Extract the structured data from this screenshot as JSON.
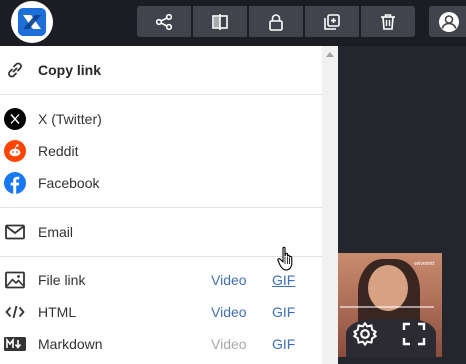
{
  "toolbar": {
    "logo": "app-logo",
    "buttons": [
      "share-icon",
      "compare-icon",
      "lock-icon",
      "add-to-collection-icon",
      "trash-icon"
    ],
    "account": "user-icon"
  },
  "share_menu": {
    "copy_link": "Copy link",
    "social": [
      {
        "label": "X (Twitter)",
        "icon": "x-twitter-icon",
        "color": "#000000"
      },
      {
        "label": "Reddit",
        "icon": "reddit-icon",
        "color": "#ff4500"
      },
      {
        "label": "Facebook",
        "icon": "facebook-icon",
        "color": "#1877f2"
      }
    ],
    "email": "Email",
    "embeds": [
      {
        "label": "File link",
        "video": "Video",
        "gif": "GIF"
      },
      {
        "label": "HTML",
        "video": "Video",
        "gif": "GIF"
      },
      {
        "label": "Markdown",
        "video": "Video",
        "gif": "GIF"
      }
    ]
  },
  "video_thumbnail": {
    "brand": "velvetmtt"
  },
  "colors": {
    "link": "#3f6fb5",
    "disabled": "#aaaaaa",
    "toolbar_bg": "#1b1d22",
    "button_bg": "#41444d"
  }
}
